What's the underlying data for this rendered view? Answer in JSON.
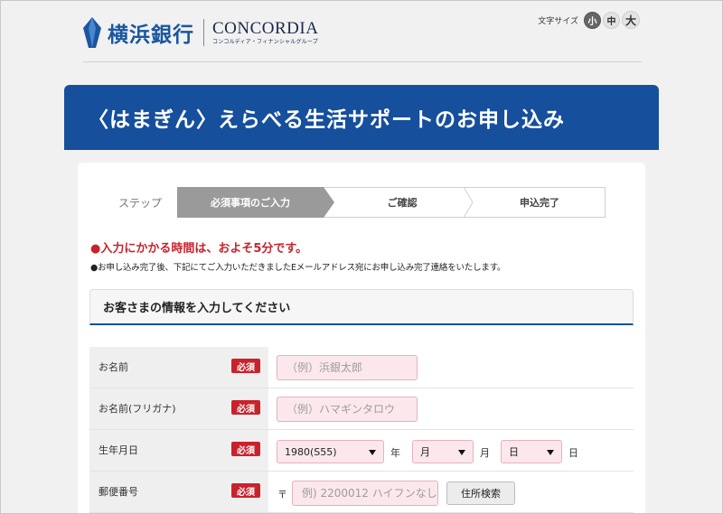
{
  "header": {
    "bank_name": "横浜銀行",
    "group_name": "CONCORDIA",
    "group_sub": "コンコルディア・フィナンシャルグループ",
    "font_size_label": "文字サイズ",
    "font_sizes": [
      "小",
      "中",
      "大"
    ],
    "font_size_selected": "小"
  },
  "banner": {
    "title": "〈はまぎん〉えらべる生活サポートのお申し込み"
  },
  "steps": {
    "label": "ステップ",
    "items": [
      "必須事項のご入力",
      "ご確認",
      "申込完了"
    ],
    "current": "必須事項のご入力"
  },
  "notices": {
    "time": "●入力にかかる時間は、およそ5分です。",
    "email": "●お申し込み完了後、下記にてご入力いただきましたEメールアドレス宛にお申し込み完了連絡をいたします。"
  },
  "section": {
    "title": "お客さまの情報を入力してください"
  },
  "form": {
    "required_label": "必須",
    "name": {
      "label": "お名前",
      "placeholder": "（例）浜銀太郎"
    },
    "kana": {
      "label": "お名前(フリガナ)",
      "placeholder": "（例）ハマギンタロウ"
    },
    "birth": {
      "label": "生年月日",
      "year_value": "1980(S55)",
      "year_unit": "年",
      "month_value": "月",
      "month_unit": "月",
      "day_value": "日",
      "day_unit": "日"
    },
    "postal": {
      "label": "郵便番号",
      "mark": "〒",
      "placeholder": "例) 2200012 ハイフンなし",
      "search_button": "住所検索"
    }
  },
  "colors": {
    "brand_blue": "#164f9c",
    "required_red": "#c8232c",
    "input_pink": "#fce8ec",
    "step_active": "#9a9a9a"
  }
}
